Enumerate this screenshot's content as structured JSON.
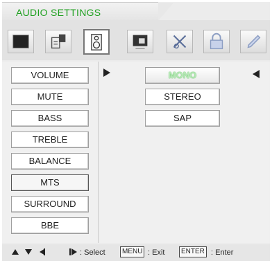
{
  "header": {
    "title": "AUDIO SETTINGS"
  },
  "icon_bar": {
    "icons": [
      {
        "name": "picture-icon"
      },
      {
        "name": "channel-icon"
      },
      {
        "name": "speaker-icon",
        "active": true
      },
      {
        "name": "time-icon"
      },
      {
        "name": "tools-icon"
      },
      {
        "name": "lock-icon"
      },
      {
        "name": "pencil-icon"
      }
    ]
  },
  "menu": {
    "items": [
      {
        "label": "VOLUME"
      },
      {
        "label": "MUTE"
      },
      {
        "label": "BASS"
      },
      {
        "label": "TREBLE"
      },
      {
        "label": "BALANCE"
      },
      {
        "label": "MTS",
        "selected": true
      },
      {
        "label": "SURROUND"
      },
      {
        "label": "BBE"
      }
    ]
  },
  "options": {
    "items": [
      {
        "label": "MONO",
        "highlighted": true
      },
      {
        "label": "STEREO"
      },
      {
        "label": "SAP"
      }
    ]
  },
  "footer": {
    "select_text": ": Select",
    "menu_key": "MENU",
    "exit_text": ": Exit",
    "enter_key": "ENTER",
    "enter_text": ": Enter"
  },
  "colors": {
    "title_green": "#1fa020",
    "highlight_green": "#4bbf4b"
  }
}
